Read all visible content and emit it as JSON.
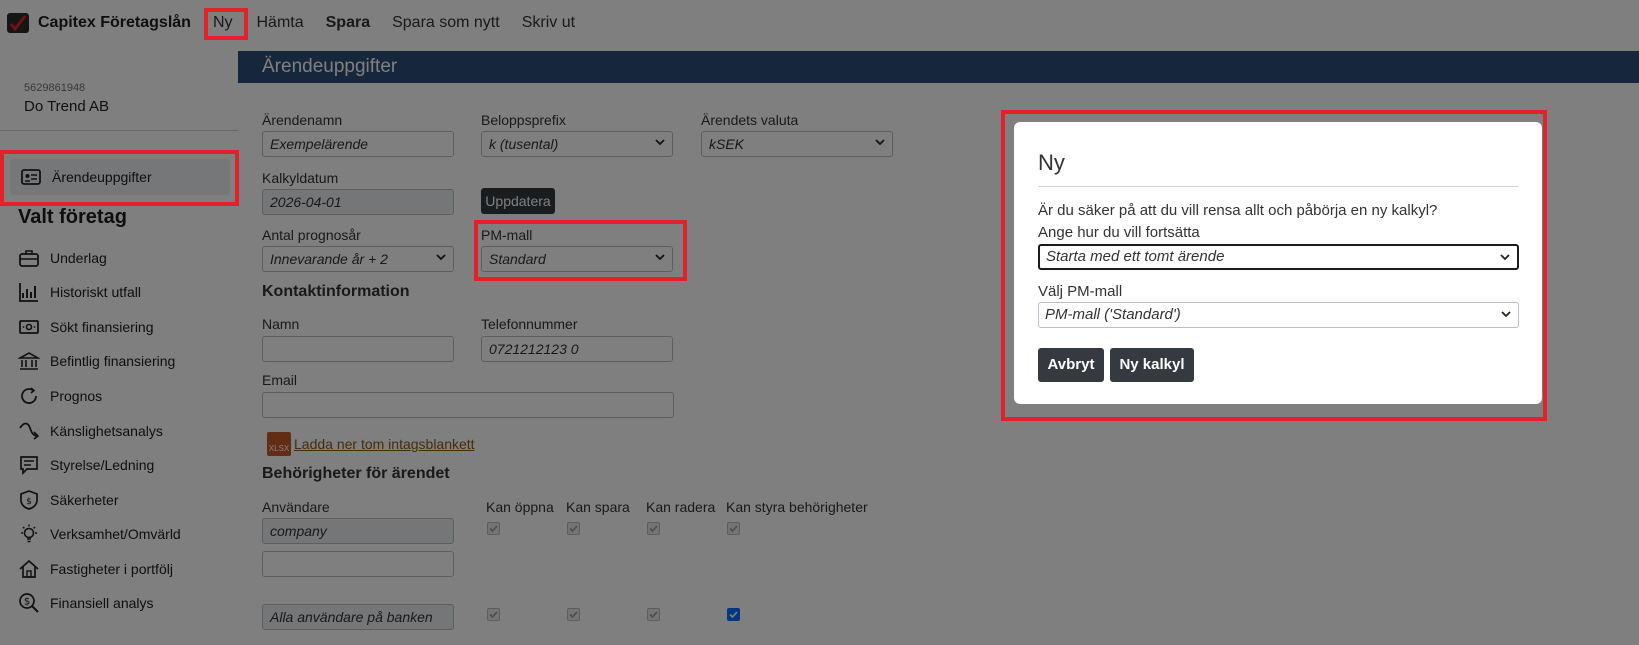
{
  "app": {
    "title": "Capitex Företagslån"
  },
  "nav": {
    "items": [
      "Ny",
      "Hämta",
      "Spara",
      "Spara som nytt",
      "Skriv ut"
    ]
  },
  "sidebar": {
    "org_number": "5629861948",
    "company": "Do Trend AB",
    "active_item": "Ärendeuppgifter",
    "heading": "Valt företag",
    "items": [
      {
        "label": "Underlag",
        "icon": "briefcase-icon"
      },
      {
        "label": "Historiskt utfall",
        "icon": "bar-chart-icon"
      },
      {
        "label": "Sökt finansiering",
        "icon": "money-icon"
      },
      {
        "label": "Befintlig finansiering",
        "icon": "bank-icon"
      },
      {
        "label": "Prognos",
        "icon": "refresh-icon"
      },
      {
        "label": "Känslighetsanalys",
        "icon": "curve-arrow-icon"
      },
      {
        "label": "Styrelse/Ledning",
        "icon": "chat-icon"
      },
      {
        "label": "Säkerheter",
        "icon": "shield-icon"
      },
      {
        "label": "Verksamhet/Omvärld",
        "icon": "lightbulb-icon"
      },
      {
        "label": "Fastigheter i portfölj",
        "icon": "house-icon"
      },
      {
        "label": "Finansiell analys",
        "icon": "dollar-search-icon"
      }
    ]
  },
  "main": {
    "section_title": "Ärendeuppgifter",
    "case_name_label": "Ärendenamn",
    "case_name_value": "Exempelärende",
    "amount_prefix_label": "Beloppsprefix",
    "amount_prefix_value": "k (tusental)",
    "currency_label": "Ärendets valuta",
    "currency_value": "kSEK",
    "calc_date_label": "Kalkyldatum",
    "calc_date_value": "2026-04-01",
    "update_button": "Uppdatera",
    "forecast_years_label": "Antal prognosår",
    "forecast_years_value": "Innevarande år + 2",
    "pm_template_label": "PM-mall",
    "pm_template_value": "Standard",
    "contact_heading": "Kontaktinformation",
    "name_label": "Namn",
    "name_value": "",
    "phone_label": "Telefonnummer",
    "phone_value": "0721212123 0",
    "email_label": "Email",
    "email_value": "",
    "xlsx_badge": "XLSX",
    "download_link": "Ladda ner tom intagsblankett",
    "permissions_heading": "Behörigheter för ärendet",
    "user_col": "Användare",
    "perm_cols": [
      "Kan öppna",
      "Kan spara",
      "Kan radera",
      "Kan styra behörigheter"
    ],
    "user_rows": [
      {
        "user": "company",
        "checks": [
          true,
          true,
          true,
          true
        ]
      },
      {
        "user": "",
        "checks": []
      },
      {
        "user": "Alla användare på banken",
        "checks": [
          true,
          true,
          true,
          true
        ]
      }
    ]
  },
  "modal": {
    "title": "Ny",
    "question": "Är du säker på att du vill rensa allt och påbörja en ny kalkyl?",
    "continue_label": "Ange hur du vill fortsätta",
    "continue_value": "Starta med ett tomt ärende",
    "pm_label": "Välj PM-mall",
    "pm_value": "PM-mall ('Standard')",
    "cancel_button": "Avbryt",
    "confirm_button": "Ny kalkyl"
  },
  "colors": {
    "section_bar": "#2c4e78",
    "dark_button": "#343a40",
    "highlight": "#e3212b",
    "checkbox_on": "#0d6efd"
  }
}
